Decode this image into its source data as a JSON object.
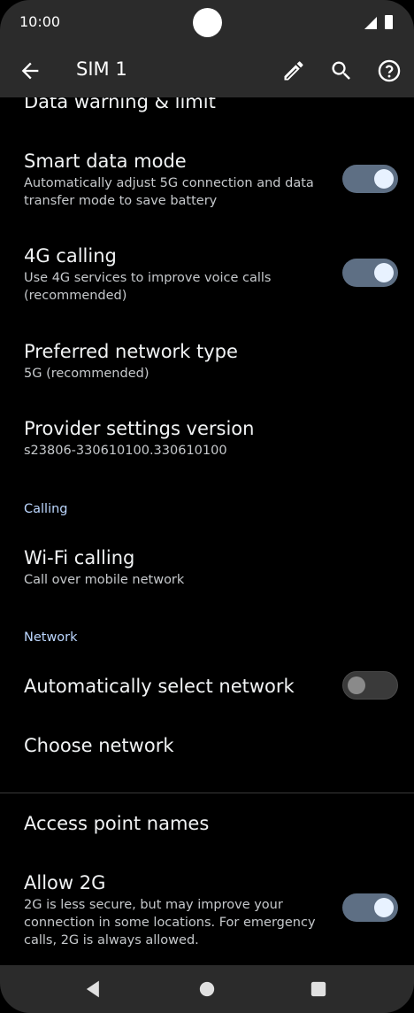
{
  "status_bar": {
    "time": "10:00"
  },
  "app_bar": {
    "title": "SIM 1"
  },
  "items": [
    {
      "title": "Data warning & limit",
      "subtitle": ""
    },
    {
      "title": "Smart data mode",
      "subtitle": "Automatically adjust 5G connection and data transfer mode to save battery",
      "toggle": "on"
    },
    {
      "title": "4G calling",
      "subtitle": "Use 4G services to improve voice calls (recommended)",
      "toggle": "on"
    },
    {
      "title": "Preferred network type",
      "subtitle": "5G (recommended)"
    },
    {
      "title": "Provider settings version",
      "subtitle": "s23806-330610100.330610100"
    },
    {
      "title": "Wi-Fi calling",
      "subtitle": "Call over mobile network"
    },
    {
      "title": "Automatically select network",
      "subtitle": "",
      "toggle": "off"
    },
    {
      "title": "Choose network",
      "subtitle": ""
    },
    {
      "title": "Access point names",
      "subtitle": ""
    },
    {
      "title": "Allow 2G",
      "subtitle": "2G is less secure, but may improve your connection in some locations. For emergency calls, 2G is always allowed.",
      "toggle": "on"
    }
  ],
  "sections": {
    "calling": "Calling",
    "network": "Network"
  },
  "icons": {
    "back": "arrow-back-icon",
    "edit": "pencil-icon",
    "search": "search-icon",
    "help": "help-icon",
    "nav_back": "triangle-back-icon",
    "nav_home": "circle-home-icon",
    "nav_recents": "square-recents-icon"
  },
  "colors": {
    "background": "#000000",
    "bars": "#2b2b2b",
    "toggle_on": "#5e6f84",
    "section_header": "#bcd7ff"
  }
}
